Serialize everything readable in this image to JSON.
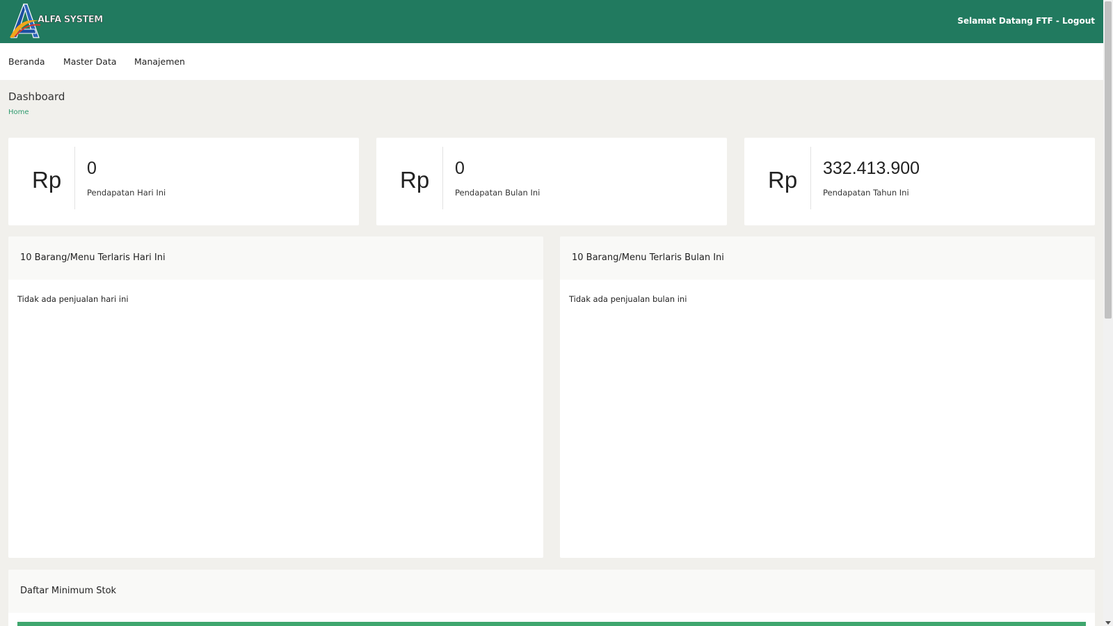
{
  "header": {
    "logo_text": "ALFA SYSTEM",
    "welcome": "Selamat Datang FTF - Logout"
  },
  "nav": {
    "items": [
      {
        "label": "Beranda"
      },
      {
        "label": "Master Data"
      },
      {
        "label": "Manajemen"
      }
    ]
  },
  "page": {
    "title": "Dashboard",
    "breadcrumb": "Home"
  },
  "stats": [
    {
      "currency": "Rp",
      "value": "0",
      "label": "Pendapatan Hari Ini"
    },
    {
      "currency": "Rp",
      "value": "0",
      "label": "Pendapatan Bulan Ini"
    },
    {
      "currency": "Rp",
      "value": "332.413.900",
      "label": "Pendapatan Tahun Ini"
    }
  ],
  "panels": {
    "today": {
      "title": "10 Barang/Menu Terlaris Hari Ini",
      "empty_text": "Tidak ada penjualan hari ini"
    },
    "month": {
      "title": "10 Barang/Menu Terlaris Bulan Ini",
      "empty_text": "Tidak ada penjualan bulan ini"
    },
    "stock": {
      "title": "Daftar Minimum Stok"
    }
  },
  "colors": {
    "header_bg": "#217a5f",
    "accent_green": "#2e9a6e",
    "table_header_green": "#3fa66e",
    "page_bg": "#f1f0ec"
  },
  "icons": {
    "logo": "alfa-system-logo",
    "scroll_down": "chevron-down-icon"
  }
}
